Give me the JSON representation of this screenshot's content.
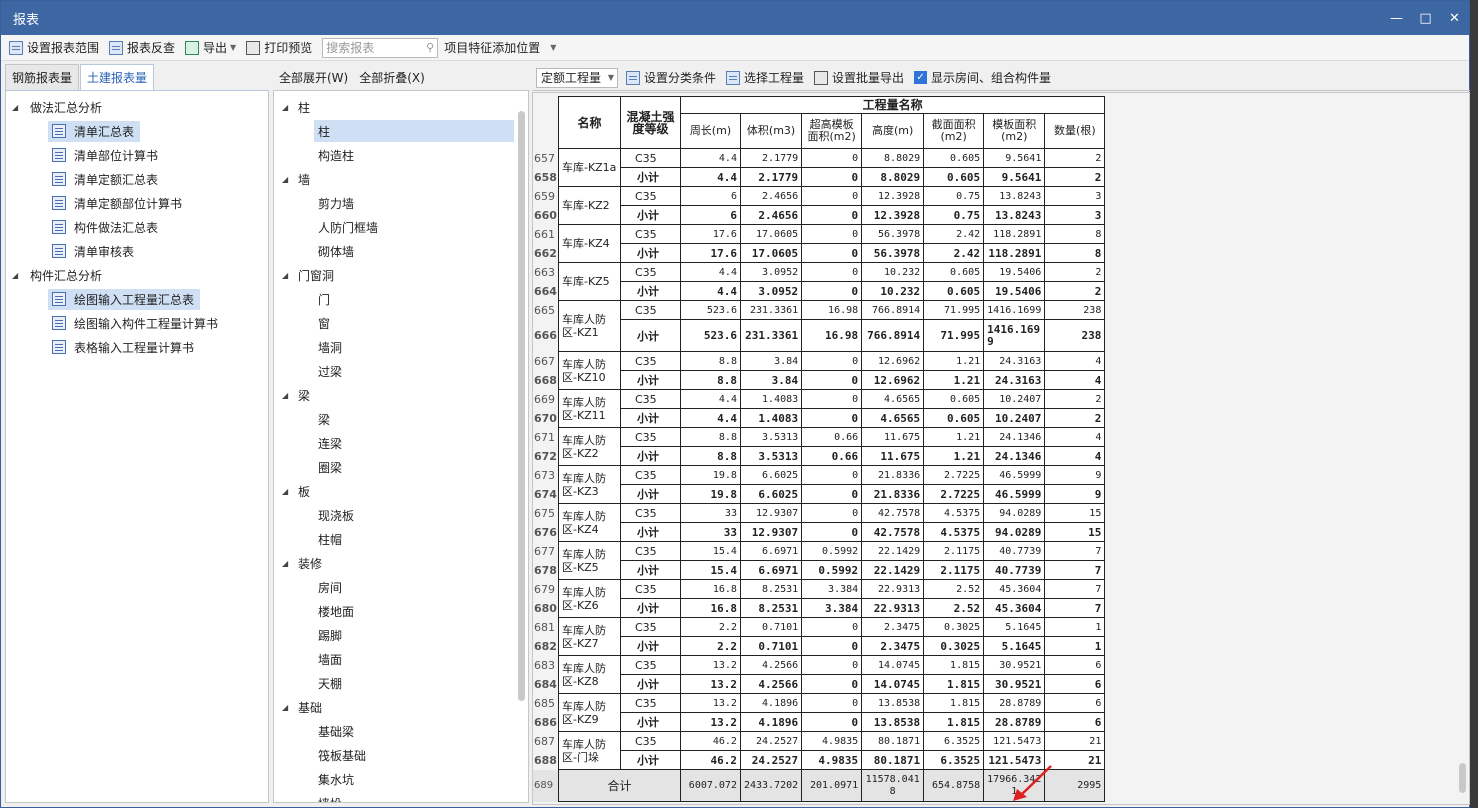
{
  "window": {
    "title": "报表",
    "ctrl_min": "—",
    "ctrl_max": "□",
    "ctrl_close": "✕"
  },
  "toolbar": {
    "set_range": "设置报表范围",
    "reverse": "报表反查",
    "export": "导出",
    "print_preview": "打印预览",
    "search_placeholder": "搜索报表",
    "feature_pos": "项目特征添加位置"
  },
  "left": {
    "tabs": [
      "钢筋报表量",
      "土建报表量"
    ],
    "groups": [
      {
        "label": "做法汇总分析",
        "items": [
          "清单汇总表",
          "清单部位计算书",
          "清单定额汇总表",
          "清单定额部位计算书",
          "构件做法汇总表",
          "清单审核表"
        ]
      },
      {
        "label": "构件汇总分析",
        "items": [
          "绘图输入工程量汇总表",
          "绘图输入构件工程量计算书",
          "表格输入工程量计算书"
        ]
      }
    ]
  },
  "middle": {
    "expand_all": "全部展开(W)",
    "collapse_all": "全部折叠(X)",
    "groups": [
      {
        "label": "柱",
        "items": [
          "柱",
          "构造柱"
        ]
      },
      {
        "label": "墙",
        "items": [
          "剪力墙",
          "人防门框墙",
          "砌体墙"
        ]
      },
      {
        "label": "门窗洞",
        "items": [
          "门",
          "窗",
          "墙洞",
          "过梁"
        ]
      },
      {
        "label": "梁",
        "items": [
          "梁",
          "连梁",
          "圈梁"
        ]
      },
      {
        "label": "板",
        "items": [
          "现浇板",
          "柱帽"
        ]
      },
      {
        "label": "装修",
        "items": [
          "房间",
          "楼地面",
          "踢脚",
          "墙面",
          "天棚"
        ]
      },
      {
        "label": "基础",
        "items": [
          "基础梁",
          "筏板基础",
          "集水坑",
          "墙垛"
        ]
      }
    ]
  },
  "right": {
    "toolbar": {
      "combo": "定额工程量",
      "set_category": "设置分类条件",
      "choose_qty": "选择工程量",
      "batch_export": "设置批量导出",
      "show_rooms": "显示房间、组合构件量"
    },
    "table": {
      "group_header": "工程量名称",
      "col_name": "名称",
      "col_grade": "混凝土强度等级",
      "cols": [
        "周长(m)",
        "体积(m3)",
        "超高模板面积(m2)",
        "高度(m)",
        "截面面积(m2)",
        "模板面积(m2)",
        "数量(根)"
      ],
      "rows": [
        {
          "rn": [
            "657",
            "658"
          ],
          "name": "车库-KZ1a",
          "c35": [
            "4.4",
            "2.1779",
            "0",
            "8.8029",
            "0.605",
            "9.5641",
            "2"
          ],
          "sub": [
            "4.4",
            "2.1779",
            "0",
            "8.8029",
            "0.605",
            "9.5641",
            "2"
          ]
        },
        {
          "rn": [
            "659",
            "660"
          ],
          "name": "车库-KZ2",
          "c35": [
            "6",
            "2.4656",
            "0",
            "12.3928",
            "0.75",
            "13.8243",
            "3"
          ],
          "sub": [
            "6",
            "2.4656",
            "0",
            "12.3928",
            "0.75",
            "13.8243",
            "3"
          ]
        },
        {
          "rn": [
            "661",
            "662"
          ],
          "name": "车库-KZ4",
          "c35": [
            "17.6",
            "17.0605",
            "0",
            "56.3978",
            "2.42",
            "118.2891",
            "8"
          ],
          "sub": [
            "17.6",
            "17.0605",
            "0",
            "56.3978",
            "2.42",
            "118.2891",
            "8"
          ]
        },
        {
          "rn": [
            "663",
            "664"
          ],
          "name": "车库-KZ5",
          "c35": [
            "4.4",
            "3.0952",
            "0",
            "10.232",
            "0.605",
            "19.5406",
            "2"
          ],
          "sub": [
            "4.4",
            "3.0952",
            "0",
            "10.232",
            "0.605",
            "19.5406",
            "2"
          ]
        },
        {
          "rn": [
            "665",
            "666"
          ],
          "name": "车库人防区-KZ1",
          "c35": [
            "523.6",
            "231.3361",
            "16.98",
            "766.8914",
            "71.995",
            "1416.1699",
            "238"
          ],
          "sub": [
            "523.6",
            "231.3361",
            "16.98",
            "766.8914",
            "71.995",
            "1416.1699",
            "238"
          ],
          "tall": true
        },
        {
          "rn": [
            "667",
            "668"
          ],
          "name": "车库人防区-KZ10",
          "c35": [
            "8.8",
            "3.84",
            "0",
            "12.6962",
            "1.21",
            "24.3163",
            "4"
          ],
          "sub": [
            "8.8",
            "3.84",
            "0",
            "12.6962",
            "1.21",
            "24.3163",
            "4"
          ]
        },
        {
          "rn": [
            "669",
            "670"
          ],
          "name": "车库人防区-KZ11",
          "c35": [
            "4.4",
            "1.4083",
            "0",
            "4.6565",
            "0.605",
            "10.2407",
            "2"
          ],
          "sub": [
            "4.4",
            "1.4083",
            "0",
            "4.6565",
            "0.605",
            "10.2407",
            "2"
          ]
        },
        {
          "rn": [
            "671",
            "672"
          ],
          "name": "车库人防区-KZ2",
          "c35": [
            "8.8",
            "3.5313",
            "0.66",
            "11.675",
            "1.21",
            "24.1346",
            "4"
          ],
          "sub": [
            "8.8",
            "3.5313",
            "0.66",
            "11.675",
            "1.21",
            "24.1346",
            "4"
          ]
        },
        {
          "rn": [
            "673",
            "674"
          ],
          "name": "车库人防区-KZ3",
          "c35": [
            "19.8",
            "6.6025",
            "0",
            "21.8336",
            "2.7225",
            "46.5999",
            "9"
          ],
          "sub": [
            "19.8",
            "6.6025",
            "0",
            "21.8336",
            "2.7225",
            "46.5999",
            "9"
          ]
        },
        {
          "rn": [
            "675",
            "676"
          ],
          "name": "车库人防区-KZ4",
          "c35": [
            "33",
            "12.9307",
            "0",
            "42.7578",
            "4.5375",
            "94.0289",
            "15"
          ],
          "sub": [
            "33",
            "12.9307",
            "0",
            "42.7578",
            "4.5375",
            "94.0289",
            "15"
          ]
        },
        {
          "rn": [
            "677",
            "678"
          ],
          "name": "车库人防区-KZ5",
          "c35": [
            "15.4",
            "6.6971",
            "0.5992",
            "22.1429",
            "2.1175",
            "40.7739",
            "7"
          ],
          "sub": [
            "15.4",
            "6.6971",
            "0.5992",
            "22.1429",
            "2.1175",
            "40.7739",
            "7"
          ]
        },
        {
          "rn": [
            "679",
            "680"
          ],
          "name": "车库人防区-KZ6",
          "c35": [
            "16.8",
            "8.2531",
            "3.384",
            "22.9313",
            "2.52",
            "45.3604",
            "7"
          ],
          "sub": [
            "16.8",
            "8.2531",
            "3.384",
            "22.9313",
            "2.52",
            "45.3604",
            "7"
          ]
        },
        {
          "rn": [
            "681",
            "682"
          ],
          "name": "车库人防区-KZ7",
          "c35": [
            "2.2",
            "0.7101",
            "0",
            "2.3475",
            "0.3025",
            "5.1645",
            "1"
          ],
          "sub": [
            "2.2",
            "0.7101",
            "0",
            "2.3475",
            "0.3025",
            "5.1645",
            "1"
          ]
        },
        {
          "rn": [
            "683",
            "684"
          ],
          "name": "车库人防区-KZ8",
          "c35": [
            "13.2",
            "4.2566",
            "0",
            "14.0745",
            "1.815",
            "30.9521",
            "6"
          ],
          "sub": [
            "13.2",
            "4.2566",
            "0",
            "14.0745",
            "1.815",
            "30.9521",
            "6"
          ]
        },
        {
          "rn": [
            "685",
            "686"
          ],
          "name": "车库人防区-KZ9",
          "c35": [
            "13.2",
            "4.1896",
            "0",
            "13.8538",
            "1.815",
            "28.8789",
            "6"
          ],
          "sub": [
            "13.2",
            "4.1896",
            "0",
            "13.8538",
            "1.815",
            "28.8789",
            "6"
          ]
        },
        {
          "rn": [
            "687",
            "688"
          ],
          "name": "车库人防区-门垛",
          "c35": [
            "46.2",
            "24.2527",
            "4.9835",
            "80.1871",
            "6.3525",
            "121.5473",
            "21"
          ],
          "sub": [
            "46.2",
            "24.2527",
            "4.9835",
            "80.1871",
            "6.3525",
            "121.5473",
            "21"
          ]
        }
      ],
      "grade_label": "C35",
      "subtotal_label": "小计",
      "total": {
        "rn": "689",
        "label": "合计",
        "values": [
          "6007.072",
          "2433.7202",
          "201.0971",
          "11578.0418",
          "654.8758",
          "17966.3421",
          "2995"
        ]
      }
    }
  },
  "colors": {
    "title_bar": "#3c67a3",
    "selected": "#cfe0f5",
    "arrow": "#e02020"
  }
}
